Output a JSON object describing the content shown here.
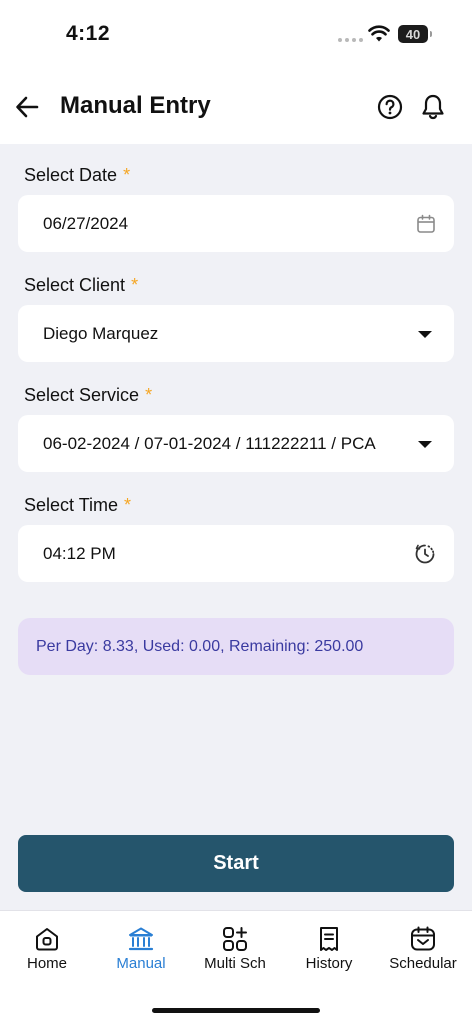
{
  "status_bar": {
    "time": "4:12",
    "battery": "40"
  },
  "header": {
    "title": "Manual Entry",
    "icons": [
      "back-arrow-icon",
      "help-icon",
      "bell-icon"
    ]
  },
  "form": {
    "required_mark": "*",
    "date": {
      "label": "Select Date",
      "value": "06/27/2024",
      "icon": "calendar-icon"
    },
    "client": {
      "label": "Select Client",
      "value": "Diego Marquez"
    },
    "service": {
      "label": "Select Service",
      "value": "06-02-2024 / 07-01-2024 / 111222211 / PCA"
    },
    "time": {
      "label": "Select Time",
      "value": "04:12 PM",
      "icon": "clock-icon"
    }
  },
  "info": {
    "text": "Per Day: 8.33, Used: 0.00, Remaining: 250.00"
  },
  "actions": {
    "start_label": "Start"
  },
  "bottom_nav": {
    "active": "Manual",
    "items": [
      {
        "label": "Home",
        "icon": "home-icon"
      },
      {
        "label": "Manual",
        "icon": "bank-icon"
      },
      {
        "label": "Multi Sch",
        "icon": "grid-add-icon"
      },
      {
        "label": "History",
        "icon": "receipt-icon"
      },
      {
        "label": "Schedular",
        "icon": "calendar-icon"
      }
    ]
  },
  "colors": {
    "primary_button": "#25556c",
    "active_nav": "#2a7fd4",
    "required_star": "#f5a623",
    "info_background": "#e6ddf6",
    "info_text": "#3a3aa0",
    "page_background": "#f0f1f6"
  }
}
